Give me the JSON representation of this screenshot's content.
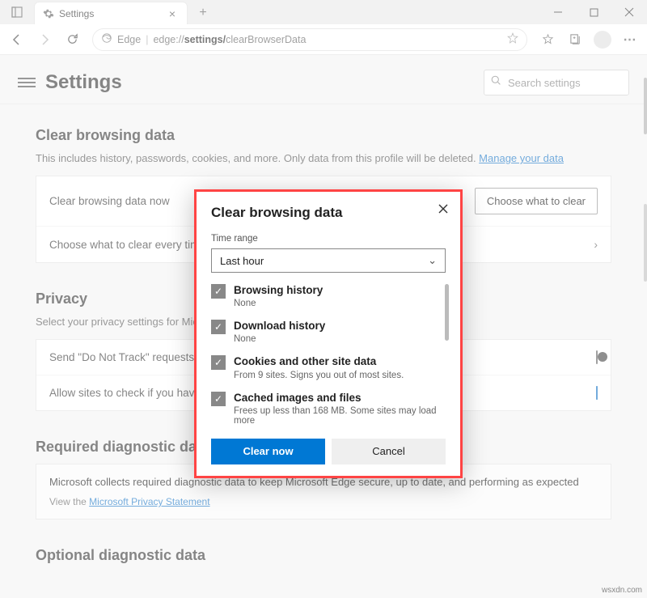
{
  "window": {
    "tab_title": "Settings",
    "address_label": "Edge",
    "url_prefix": "edge://",
    "url_mid": "settings/",
    "url_end": "clearBrowserData"
  },
  "header": {
    "title": "Settings",
    "search_placeholder": "Search settings"
  },
  "clear": {
    "title": "Clear browsing data",
    "desc": "This includes history, passwords, cookies, and more. Only data from this profile will be deleted. ",
    "manage_link": "Manage your data",
    "row1": "Clear browsing data now",
    "row1_btn": "Choose what to clear",
    "row2": "Choose what to clear every time you close the browser"
  },
  "privacy": {
    "title": "Privacy",
    "desc": "Select your privacy settings for Microsoft Edge.",
    "row1": "Send \"Do Not Track\" requests",
    "row2": "Allow sites to check if you have payment methods saved"
  },
  "diag": {
    "title": "Required diagnostic data",
    "body": "Microsoft collects required diagnostic data to keep Microsoft Edge secure, up to date, and performing as expected",
    "view": "View the ",
    "view_link": "Microsoft Privacy Statement"
  },
  "opt": {
    "title": "Optional diagnostic data"
  },
  "dialog": {
    "title": "Clear browsing data",
    "time_label": "Time range",
    "time_value": "Last hour",
    "items": [
      {
        "t": "Browsing history",
        "d": "None"
      },
      {
        "t": "Download history",
        "d": "None"
      },
      {
        "t": "Cookies and other site data",
        "d": "From 9 sites. Signs you out of most sites."
      },
      {
        "t": "Cached images and files",
        "d": "Frees up less than 168 MB. Some sites may load more"
      }
    ],
    "clear_btn": "Clear now",
    "cancel_btn": "Cancel"
  },
  "watermark": "wsxdn.com"
}
